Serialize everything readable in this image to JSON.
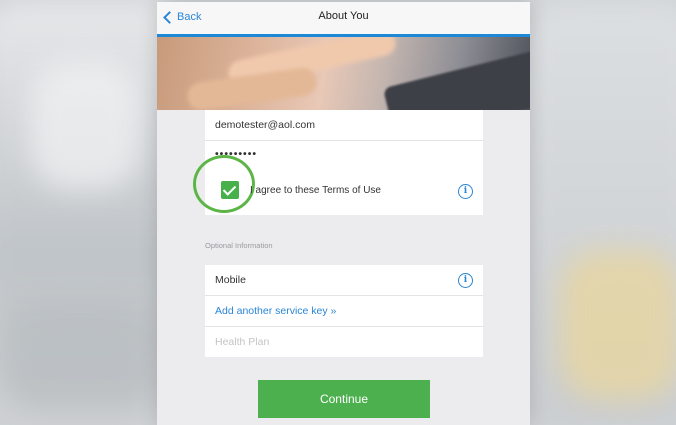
{
  "navbar": {
    "back_label": "Back",
    "title": "About You",
    "accent": "#1d88d6"
  },
  "account": {
    "email": "demotester@aol.com",
    "password_masked": "•••••••••"
  },
  "terms": {
    "checked": true,
    "label": "I agree to these Terms of Use",
    "icon": "info-icon"
  },
  "optional": {
    "section_label": "Optional Information",
    "mobile_label": "Mobile",
    "add_service_key": "Add another service key »",
    "health_plan_placeholder": "Health Plan"
  },
  "continue_button": {
    "label": "Continue",
    "color": "#4cb04f"
  }
}
